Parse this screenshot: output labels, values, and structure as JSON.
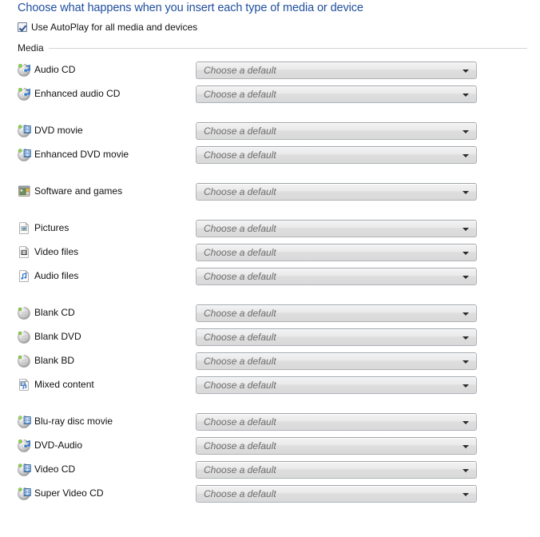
{
  "page": {
    "title": "Choose what happens when you insert each type of media or device"
  },
  "autoplay": {
    "label": "Use AutoPlay for all media and devices",
    "checked": true,
    "checkbox_icon": "checkbox-checked-icon"
  },
  "media_group": {
    "label": "Media"
  },
  "combo": {
    "placeholder": "Choose a default",
    "arrow_icon": "chevron-down-icon"
  },
  "rows": [
    {
      "label": "Audio CD",
      "icon": "audio-cd-icon",
      "value": "Choose a default",
      "group_end": false
    },
    {
      "label": "Enhanced audio CD",
      "icon": "audio-cd-icon",
      "value": "Choose a default",
      "group_end": true
    },
    {
      "label": "DVD movie",
      "icon": "dvd-movie-icon",
      "value": "Choose a default",
      "group_end": false
    },
    {
      "label": "Enhanced DVD movie",
      "icon": "dvd-movie-icon",
      "value": "Choose a default",
      "group_end": true
    },
    {
      "label": "Software and games",
      "icon": "software-games-icon",
      "value": "Choose a default",
      "group_end": true
    },
    {
      "label": "Pictures",
      "icon": "pictures-file-icon",
      "value": "Choose a default",
      "group_end": false
    },
    {
      "label": "Video files",
      "icon": "video-file-icon",
      "value": "Choose a default",
      "group_end": false
    },
    {
      "label": "Audio files",
      "icon": "audio-file-icon",
      "value": "Choose a default",
      "group_end": true
    },
    {
      "label": "Blank CD",
      "icon": "blank-disc-icon",
      "value": "Choose a default",
      "group_end": false
    },
    {
      "label": "Blank DVD",
      "icon": "blank-disc-icon",
      "value": "Choose a default",
      "group_end": false
    },
    {
      "label": "Blank BD",
      "icon": "blank-disc-icon",
      "value": "Choose a default",
      "group_end": false
    },
    {
      "label": "Mixed content",
      "icon": "mixed-content-icon",
      "value": "Choose a default",
      "group_end": true
    },
    {
      "label": "Blu-ray disc movie",
      "icon": "bluray-movie-icon",
      "value": "Choose a default",
      "group_end": false
    },
    {
      "label": "DVD-Audio",
      "icon": "audio-cd-icon",
      "value": "Choose a default",
      "group_end": false
    },
    {
      "label": "Video CD",
      "icon": "dvd-movie-icon",
      "value": "Choose a default",
      "group_end": false
    },
    {
      "label": "Super Video CD",
      "icon": "dvd-movie-icon",
      "value": "Choose a default",
      "group_end": false
    }
  ],
  "colors": {
    "title_blue": "#1f4e9c",
    "combo_text_gray": "#6e6e6e",
    "rule_gray": "#d4d4d4",
    "background": "#ffffff"
  }
}
